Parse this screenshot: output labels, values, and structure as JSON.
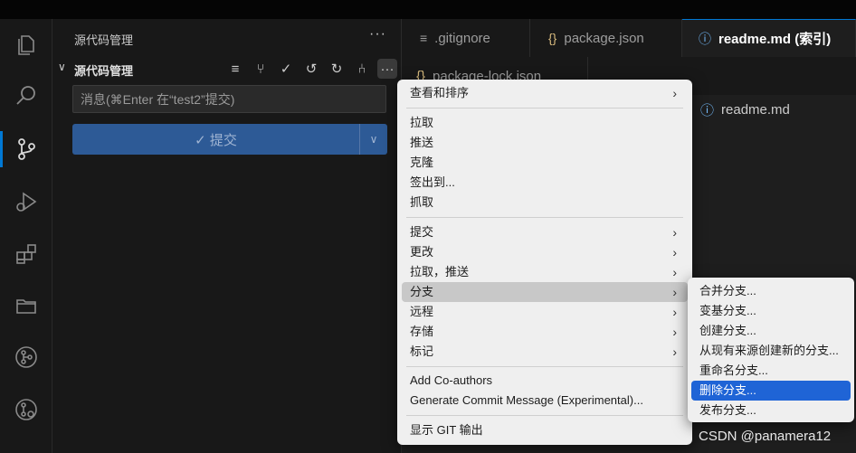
{
  "sidebar": {
    "title": "源代码管理",
    "more": "···",
    "section_label": "源代码管理",
    "message_placeholder": "消息(⌘Enter 在“test2”提交)",
    "commit_label": "✓ 提交"
  },
  "tabs": [
    {
      "icon": "≡",
      "label": ".gitignore"
    },
    {
      "icon": "{}",
      "label": "package.json"
    },
    {
      "icon": "ⓘ",
      "label": "readme.md (索引)"
    }
  ],
  "second_tab": {
    "icon": "{}",
    "label": "package-lock.json"
  },
  "breadcrumb": {
    "icon": "ⓘ",
    "label": "readme.md"
  },
  "menu": {
    "items": [
      {
        "label": "查看和排序",
        "submenu": true
      },
      {
        "label": "拉取",
        "submenu": false
      },
      {
        "label": "推送",
        "submenu": false
      },
      {
        "label": "克隆",
        "submenu": false
      },
      {
        "label": "签出到...",
        "submenu": false
      },
      {
        "label": "抓取",
        "submenu": false
      },
      {
        "label": "提交",
        "submenu": true
      },
      {
        "label": "更改",
        "submenu": true
      },
      {
        "label": "拉取，推送",
        "submenu": true
      },
      {
        "label": "分支",
        "submenu": true
      },
      {
        "label": "远程",
        "submenu": true
      },
      {
        "label": "存储",
        "submenu": true
      },
      {
        "label": "标记",
        "submenu": true
      },
      {
        "label": "Add Co-authors",
        "submenu": false
      },
      {
        "label": "Generate Commit Message (Experimental)...",
        "submenu": false
      },
      {
        "label": "显示 GIT 输出",
        "submenu": false
      }
    ]
  },
  "branch_submenu": {
    "items": [
      {
        "label": "合并分支..."
      },
      {
        "label": "变基分支..."
      },
      {
        "label": "创建分支..."
      },
      {
        "label": "从现有来源创建新的分支..."
      },
      {
        "label": "重命名分支..."
      },
      {
        "label": "删除分支..."
      },
      {
        "label": "发布分支..."
      }
    ]
  },
  "watermark": "CSDN @panamera12",
  "colors": {
    "accent": "#0078d4",
    "commit_button": "#2d5a96",
    "menu_selected": "#1f64d6"
  }
}
